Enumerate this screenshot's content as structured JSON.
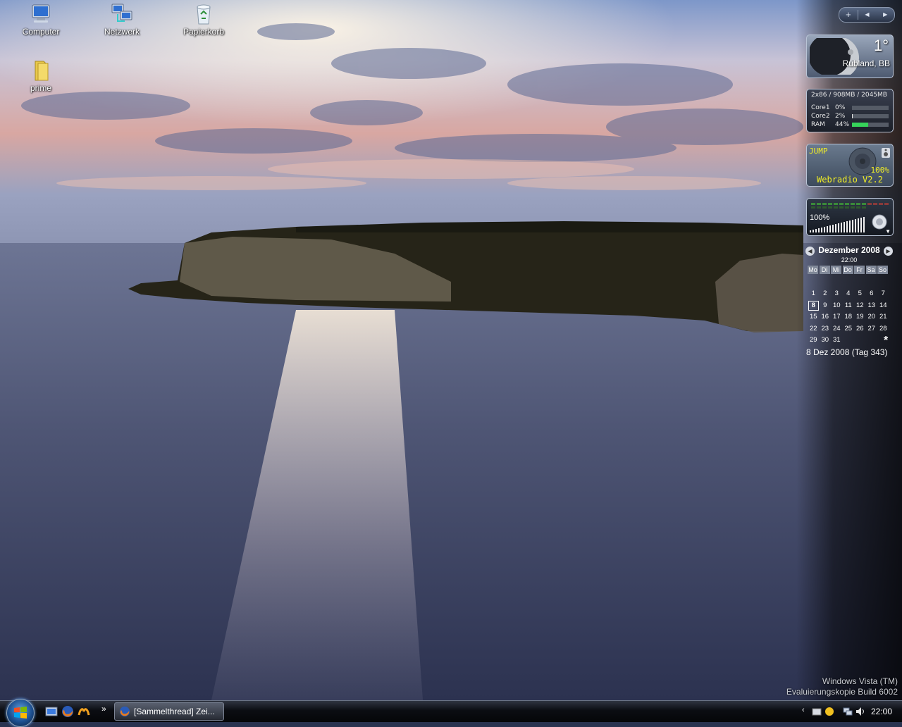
{
  "desktop": {
    "icons": [
      {
        "label": "Computer"
      },
      {
        "label": "Netzwerk"
      },
      {
        "label": "Papierkorb"
      },
      {
        "label": "prime"
      }
    ]
  },
  "sidebar": {
    "controls": {
      "add": "+",
      "prev": "◀",
      "next": "▶"
    },
    "weather": {
      "temperature": "1°",
      "location": "Rubland, BB"
    },
    "cpu_meter": {
      "header": "2x86 / 908MB / 2045MB",
      "rows": [
        {
          "name": "Core1",
          "value": "0%",
          "level": 0
        },
        {
          "name": "Core2",
          "value": "2%",
          "level": 2
        },
        {
          "name": "RAM",
          "value": "44%",
          "level": 44
        }
      ]
    },
    "webradio": {
      "station": "JUMP",
      "volume": "100%",
      "name": "Webradio V2.2"
    },
    "volume": {
      "percent": "100%",
      "level": 100
    },
    "calendar": {
      "month": "Dezember 2008",
      "time": "22:00",
      "weekdays": [
        "Mo",
        "Di",
        "Mi",
        "Do",
        "Fr",
        "Sa",
        "So"
      ],
      "weeks": [
        [
          "1",
          "2",
          "3",
          "4",
          "5",
          "6",
          "7"
        ],
        [
          "8",
          "9",
          "10",
          "11",
          "12",
          "13",
          "14"
        ],
        [
          "15",
          "16",
          "17",
          "18",
          "19",
          "20",
          "21"
        ],
        [
          "22",
          "23",
          "24",
          "25",
          "26",
          "27",
          "28"
        ],
        [
          "29",
          "30",
          "31",
          "",
          "",
          "",
          ""
        ]
      ],
      "today": "8",
      "footer": "8 Dez 2008 (Tag 343)",
      "asterisk": "*"
    }
  },
  "watermark": {
    "line1": "Windows Vista (TM)",
    "line2": "Evaluierungskopie Build 6002"
  },
  "taskbar": {
    "quick_launch_more": "»",
    "window_button": "[Sammelthread] Zei...",
    "tray": {
      "chevron": "‹",
      "clock": "22:00"
    }
  },
  "colors": {
    "sky_top": "#6f8fc8",
    "sunset": "#e8b4a0",
    "sea": "#4a5170",
    "radio_text": "#f2ef24",
    "ram_bar": "#36d35a"
  }
}
